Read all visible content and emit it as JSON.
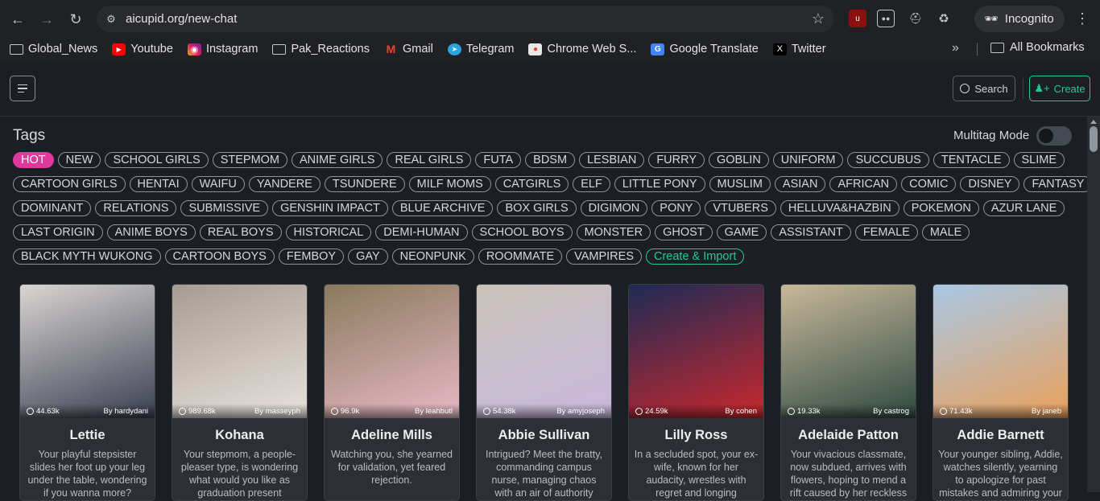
{
  "browser": {
    "url": "aicupid.org/new-chat",
    "incognito_label": "Incognito",
    "bookmarks": [
      {
        "label": "Global_News",
        "icon": "folder-icon"
      },
      {
        "label": "Youtube",
        "icon": "youtube-icon"
      },
      {
        "label": "Instagram",
        "icon": "instagram-icon"
      },
      {
        "label": "Pak_Reactions",
        "icon": "folder-icon"
      },
      {
        "label": "Gmail",
        "icon": "gmail-icon"
      },
      {
        "label": "Telegram",
        "icon": "telegram-icon"
      },
      {
        "label": "Chrome Web S...",
        "icon": "chrome-web-store-icon"
      },
      {
        "label": "Google Translate",
        "icon": "google-translate-icon"
      },
      {
        "label": "Twitter",
        "icon": "x-twitter-icon"
      }
    ],
    "all_bookmarks_label": "All Bookmarks"
  },
  "header": {
    "search_label": "Search",
    "create_label": "Create"
  },
  "tags": {
    "title": "Tags",
    "multitag_label": "Multitag Mode",
    "rows": [
      [
        "HOT",
        "NEW",
        "SCHOOL GIRLS",
        "STEPMOM",
        "ANIME GIRLS",
        "REAL GIRLS",
        "FUTA",
        "BDSM",
        "LESBIAN",
        "FURRY",
        "GOBLIN",
        "UNIFORM",
        "SUCCUBUS",
        "TENTACLE",
        "SLIME"
      ],
      [
        "CARTOON GIRLS",
        "HENTAI",
        "WAIFU",
        "YANDERE",
        "TSUNDERE",
        "MILF MOMS",
        "CATGIRLS",
        "ELF",
        "LITTLE PONY",
        "MUSLIM",
        "ASIAN",
        "AFRICAN",
        "COMIC",
        "DISNEY",
        "FANTASY"
      ],
      [
        "DOMINANT",
        "RELATIONS",
        "SUBMISSIVE",
        "GENSHIN IMPACT",
        "BLUE ARCHIVE",
        "BOX GIRLS",
        "DIGIMON",
        "PONY",
        "VTUBERS",
        "HELLUVA&HAZBIN",
        "POKEMON",
        "AZUR LANE"
      ],
      [
        "LAST ORIGIN",
        "ANIME BOYS",
        "REAL BOYS",
        "HISTORICAL",
        "DEMI-HUMAN",
        "SCHOOL BOYS",
        "MONSTER",
        "GHOST",
        "GAME",
        "ASSISTANT",
        "FEMALE",
        "MALE"
      ],
      [
        "BLACK MYTH WUKONG",
        "CARTOON BOYS",
        "FEMBOY",
        "GAY",
        "NEONPUNK",
        "ROOMMATE",
        "VAMPIRES"
      ]
    ],
    "create_import_label": "Create & Import",
    "active_tag": "HOT"
  },
  "cards": [
    {
      "name": "Lettie",
      "count": "44.63k",
      "author": "By hardydani",
      "desc": "Your playful stepsister slides her foot up your leg under the table, wondering if you wanna more?",
      "bg": [
        "#d9d5d2",
        "#3b3f52"
      ]
    },
    {
      "name": "Kohana",
      "count": "989.68k",
      "author": "By masseyph",
      "desc": "Your stepmom, a people-pleaser type, is wondering what would you like as graduation present",
      "bg": [
        "#a79c94",
        "#e8e2dc"
      ]
    },
    {
      "name": "Adeline Mills",
      "count": "96.9k",
      "author": "By leahbutl",
      "desc": "Watching you, she yearned for validation, yet feared rejection.",
      "bg": [
        "#8a7a5c",
        "#e7b9c6"
      ]
    },
    {
      "name": "Abbie Sullivan",
      "count": "54.38k",
      "author": "By amyjoseph",
      "desc": "Intrigued? Meet the bratty, commanding campus nurse, managing chaos with an air of authority",
      "bg": [
        "#c9c2b8",
        "#c8b8de"
      ]
    },
    {
      "name": "Lilly Ross",
      "count": "24.59k",
      "author": "By cohen",
      "desc": "In a secluded spot, your ex-wife, known for her audacity, wrestles with regret and longing",
      "bg": [
        "#1e2a55",
        "#c8282e"
      ]
    },
    {
      "name": "Adelaide Patton",
      "count": "19.33k",
      "author": "By castrog",
      "desc": "Your vivacious classmate, now subdued, arrives with flowers, hoping to mend a rift caused by her reckless",
      "bg": [
        "#c8b89a",
        "#2f4a42"
      ]
    },
    {
      "name": "Addie Barnett",
      "count": "71.43k",
      "author": "By janeb",
      "desc": "Your younger sibling, Addie, watches silently, yearning to apologize for past mistakes and admiring your",
      "bg": [
        "#a9c7e4",
        "#e8a05c"
      ]
    }
  ]
}
